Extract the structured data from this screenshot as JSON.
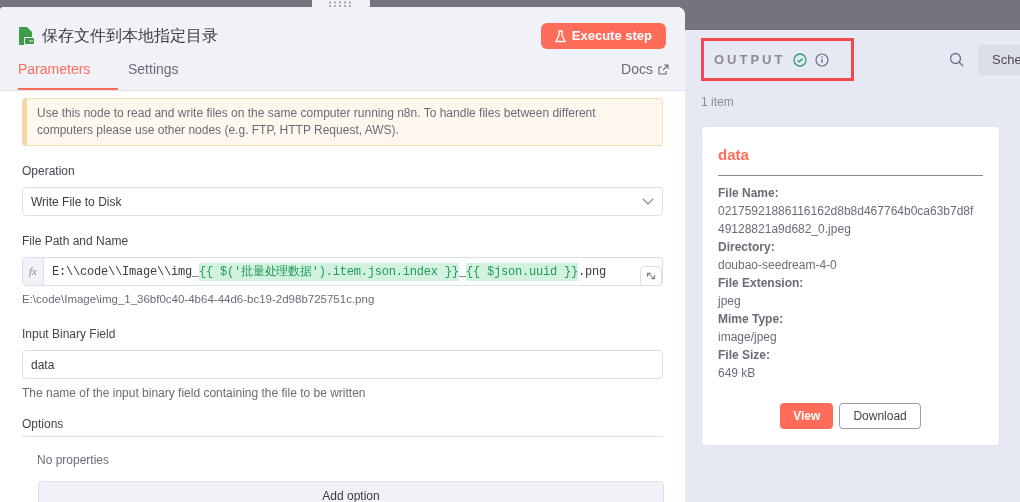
{
  "node": {
    "title": "保存文件到本地指定目录",
    "execute_button": "Execute step"
  },
  "tabs": [
    {
      "label": "Parameters",
      "selected": true
    },
    {
      "label": "Settings",
      "selected": false
    }
  ],
  "docs_link": "Docs",
  "notice": "Use this node to read and write files on the same computer running n8n. To handle files between different computers please use other nodes (e.g. FTP, HTTP Request, AWS).",
  "operation": {
    "label": "Operation",
    "value": "Write File to Disk"
  },
  "file_path": {
    "label": "File Path and Name",
    "fx": "fx",
    "segments": [
      {
        "kind": "plain",
        "text": "E:\\\\code\\\\Image\\\\img_"
      },
      {
        "kind": "expression",
        "text": "{{ $('批量处理数据').item.json.index }}"
      },
      {
        "kind": "plain",
        "text": "_"
      },
      {
        "kind": "expression",
        "text": "{{ $json.uuid }}"
      },
      {
        "kind": "plain",
        "text": ".png"
      }
    ],
    "preview": "E:\\code\\Image\\img_1_36bf0c40-4b64-44d6-bc19-2d98b725751c.png"
  },
  "binary_field": {
    "label": "Input Binary Field",
    "value": "data",
    "hint": "The name of the input binary field containing the file to be written"
  },
  "options": {
    "label": "Options",
    "empty_text": "No properties",
    "add_button": "Add option"
  },
  "output": {
    "title": "OUTPUT",
    "success": true,
    "count": "1 item",
    "schema_button": "Sche",
    "card": {
      "title": "data",
      "fields": [
        {
          "label": "File Name:",
          "value": "02175921886116162d8b8d467764b0ca63b7d8f49128821a9d682_0.jpeg"
        },
        {
          "label": "Directory:",
          "value": "doubao-seedream-4-0"
        },
        {
          "label": "File Extension:",
          "value": "jpeg"
        },
        {
          "label": "Mime Type:",
          "value": "image/jpeg"
        },
        {
          "label": "File Size:",
          "value": "649 kB"
        }
      ],
      "buttons": [
        "View",
        "Download"
      ]
    }
  }
}
